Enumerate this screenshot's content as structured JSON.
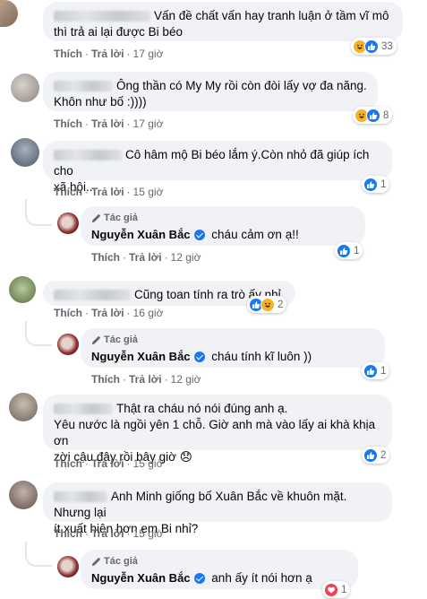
{
  "labels": {
    "like": "Thích",
    "reply": "Trả lời",
    "author_tag": "Tác giả",
    "separator": "·"
  },
  "author_name": "Nguyễn Xuân Bắc",
  "comments": [
    {
      "text_line1": "Vấn đề chất vấn hay tranh luận ở tầm vĩ mô",
      "text_line2": "thì trả ai lại được Bi béo",
      "time": "17 giờ",
      "reactions": [
        "haha",
        "like"
      ],
      "count": "33"
    },
    {
      "text_line1": "Ông thần có My My rồi còn đòi lấy vợ đa năng.",
      "text_line2": "Khôn như bố :))))",
      "time": "17 giờ",
      "reactions": [
        "haha",
        "like"
      ],
      "count": "8"
    },
    {
      "text_line1": "Cô hâm mộ Bi béo lắm ý.Còn nhỏ đã giúp ích cho",
      "text_line2": "xã hội...",
      "time": "15 giờ",
      "reactions": [
        "like"
      ],
      "count": "1"
    },
    {
      "text_line1": "Cũng toan tính ra trò ấy nhỉ",
      "text_line2": "",
      "time": "16 giờ",
      "reactions": [
        "like",
        "haha"
      ],
      "count": "2"
    },
    {
      "text_line1": "Thật ra cháu nó nói đúng anh ạ.",
      "text_line2": "Yêu nước là ngồi yên 1 chỗ. Giờ anh mà vào lấy ai khà khịa ơn",
      "text_line3": "zời cậu đây rồi bây giờ 😞",
      "time": "15 giờ",
      "reactions": [
        "like"
      ],
      "count": "2"
    },
    {
      "text_line1": "Anh Minh giống bố Xuân Bắc về khuôn mặt. Nhưng lại",
      "text_line2": "ít xuất hiện hơn em Bi nhỉ?",
      "time": "15 giờ",
      "reactions": [],
      "count": ""
    }
  ],
  "replies": [
    {
      "text": "cháu cảm ơn ạ!!",
      "time": "12 giờ",
      "reactions": [
        "like"
      ],
      "count": "1"
    },
    {
      "text": "cháu tính kĩ luôn ))",
      "time": "12 giờ",
      "reactions": [
        "like"
      ],
      "count": "1"
    },
    {
      "text": "anh ấy ít nói hơn ạ",
      "time": "",
      "reactions": [
        "love"
      ],
      "count": "1"
    }
  ],
  "colors": {
    "like": "#1877f2",
    "haha": "#f7b125",
    "love": "#f33e58",
    "meta": "#65676b",
    "bubble": "#f0f2f5"
  }
}
